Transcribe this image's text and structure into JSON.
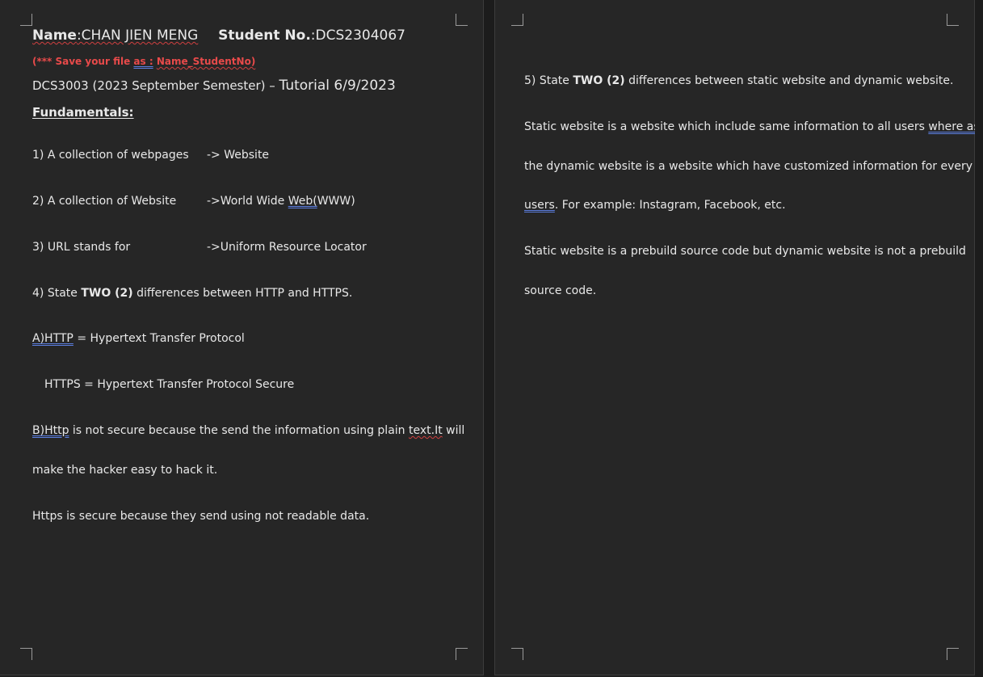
{
  "page1": {
    "name_label": "Name",
    "name_value": ":CHAN JIEN MENG",
    "student_label": "Student No.",
    "student_value": ":DCS2304067",
    "save_note_prefix": "(*** Save your file ",
    "save_note_as": "as :",
    "save_note_name": "Name_StudentNo)",
    "course_line_a": "DCS3003 (2023 September Semester) – ",
    "course_line_b": "Tutorial 6/9/2023",
    "heading": "Fundamentals:",
    "q1_question": "1) A collection of webpages",
    "q1_answer": "-> Website",
    "q2_question": "2) A collection of Website",
    "q2_answer_a": "->World Wide ",
    "q2_answer_b": "Web(",
    "q2_answer_c": "WWW)",
    "q3_question": "3) URL stands for",
    "q3_answer": "->Uniform Resource Locator",
    "q4_a": "4) State ",
    "q4_b": "TWO (2)",
    "q4_c": " differences between HTTP and HTTPS.",
    "a_http_a": "A)HTTP",
    "a_http_b": " = Hypertext Transfer Protocol",
    "a_https": "HTTPS = Hypertext Transfer Protocol Secure",
    "b_http_a": "B)Http",
    "b_http_b": " is not secure because the send the information using plain ",
    "b_http_c": "text.It",
    "b_http_d": " will",
    "b_http_line2": "make the hacker easy to hack it.",
    "https_secure": "Https is secure because they send using not readable data."
  },
  "page2": {
    "q5_a": "5) State ",
    "q5_b": "TWO (2)",
    "q5_c": " differences between static website and dynamic website.",
    "p1_l1_a": "Static website is a website which include same information to all users ",
    "p1_l1_b": "where as",
    "p1_l2": "the dynamic website is a website which have customized information for every",
    "p1_l3_a": "users",
    "p1_l3_b": ". For example: Instagram, Facebook, etc.",
    "p2_l1": "Static website is a prebuild source code but dynamic website is not a prebuild",
    "p2_l2": "source code."
  }
}
